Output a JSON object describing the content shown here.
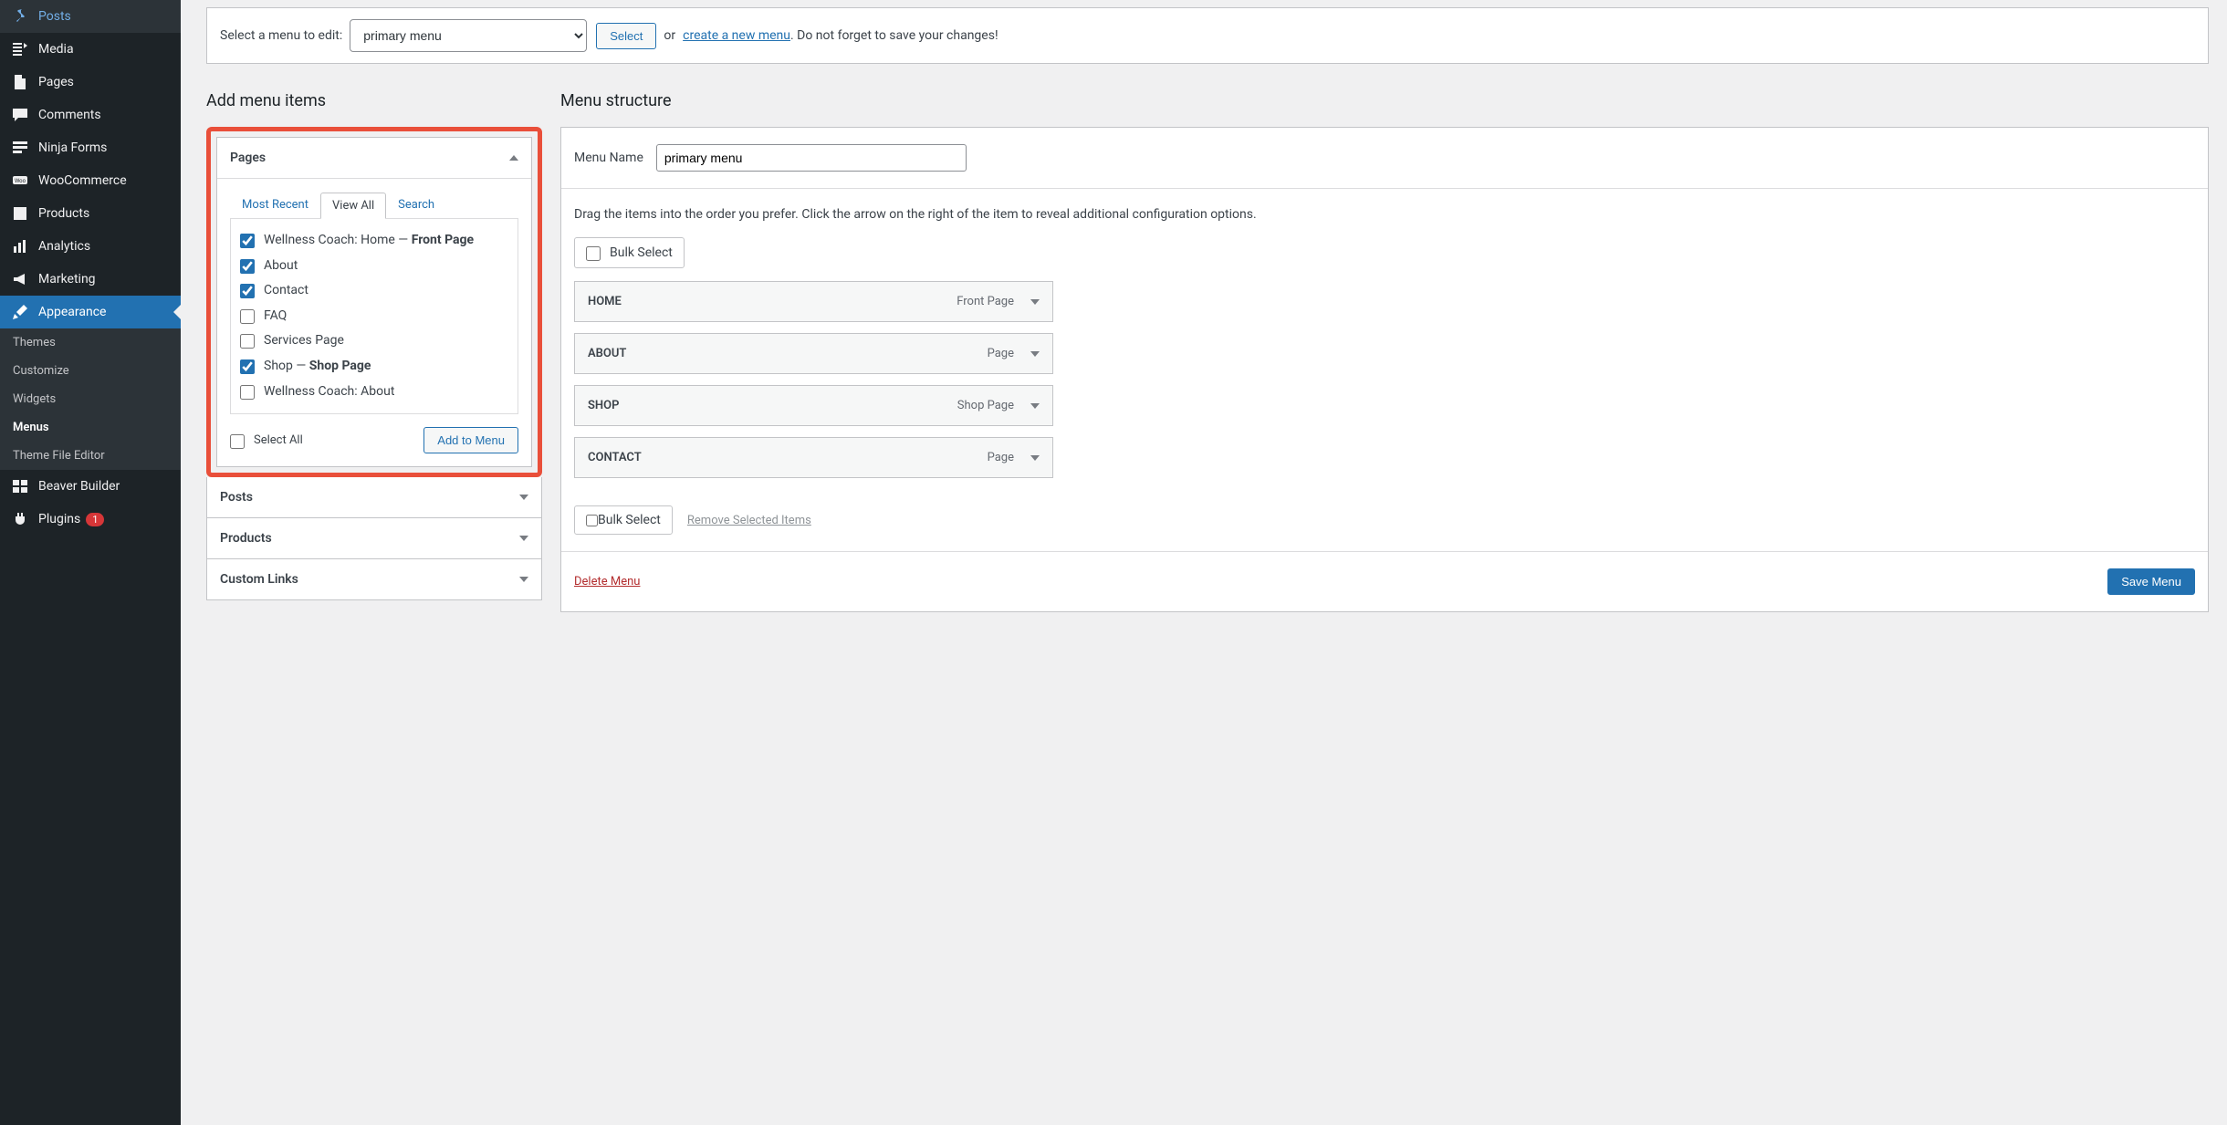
{
  "sidebar": {
    "items": [
      {
        "icon": "pin",
        "label": "Posts"
      },
      {
        "icon": "media",
        "label": "Media"
      },
      {
        "icon": "page",
        "label": "Pages"
      },
      {
        "icon": "comment",
        "label": "Comments"
      },
      {
        "icon": "form",
        "label": "Ninja Forms"
      },
      {
        "icon": "woo",
        "label": "WooCommerce"
      },
      {
        "icon": "box",
        "label": "Products"
      },
      {
        "icon": "chart",
        "label": "Analytics"
      },
      {
        "icon": "megaphone",
        "label": "Marketing"
      },
      {
        "icon": "brush",
        "label": "Appearance"
      },
      {
        "icon": "grid",
        "label": "Beaver Builder"
      },
      {
        "icon": "plug",
        "label": "Plugins"
      }
    ],
    "sub_items": [
      "Themes",
      "Customize",
      "Widgets",
      "Menus",
      "Theme File Editor"
    ],
    "plugin_count": "1"
  },
  "edit_bar": {
    "label": "Select a menu to edit:",
    "selected": "primary menu",
    "select_btn": "Select",
    "or": "or",
    "create_link": "create a new menu",
    "reminder": ". Do not forget to save your changes!"
  },
  "left": {
    "heading": "Add menu items",
    "pages_title": "Pages",
    "tabs": {
      "recent": "Most Recent",
      "all": "View All",
      "search": "Search"
    },
    "pages": [
      {
        "checked": true,
        "pre": "Wellness Coach: Home — ",
        "bold": "Front Page"
      },
      {
        "checked": true,
        "pre": "About",
        "bold": ""
      },
      {
        "checked": true,
        "pre": "Contact",
        "bold": ""
      },
      {
        "checked": false,
        "pre": "FAQ",
        "bold": ""
      },
      {
        "checked": false,
        "pre": "Services Page",
        "bold": ""
      },
      {
        "checked": true,
        "pre": "Shop — ",
        "bold": "Shop Page"
      },
      {
        "checked": false,
        "pre": "Wellness Coach: About",
        "bold": ""
      }
    ],
    "select_all": "Select All",
    "add_btn": "Add to Menu",
    "acc_posts": "Posts",
    "acc_products": "Products",
    "acc_custom": "Custom Links"
  },
  "right": {
    "heading": "Menu structure",
    "name_label": "Menu Name",
    "name_value": "primary menu",
    "instructions": "Drag the items into the order you prefer. Click the arrow on the right of the item to reveal additional configuration options.",
    "bulk_select": "Bulk Select",
    "items": [
      {
        "title": "HOME",
        "type": "Front Page"
      },
      {
        "title": "ABOUT",
        "type": "Page"
      },
      {
        "title": "SHOP",
        "type": "Shop Page"
      },
      {
        "title": "CONTACT",
        "type": "Page"
      }
    ],
    "remove_selected": "Remove Selected Items",
    "delete_menu": "Delete Menu",
    "save_menu": "Save Menu"
  }
}
